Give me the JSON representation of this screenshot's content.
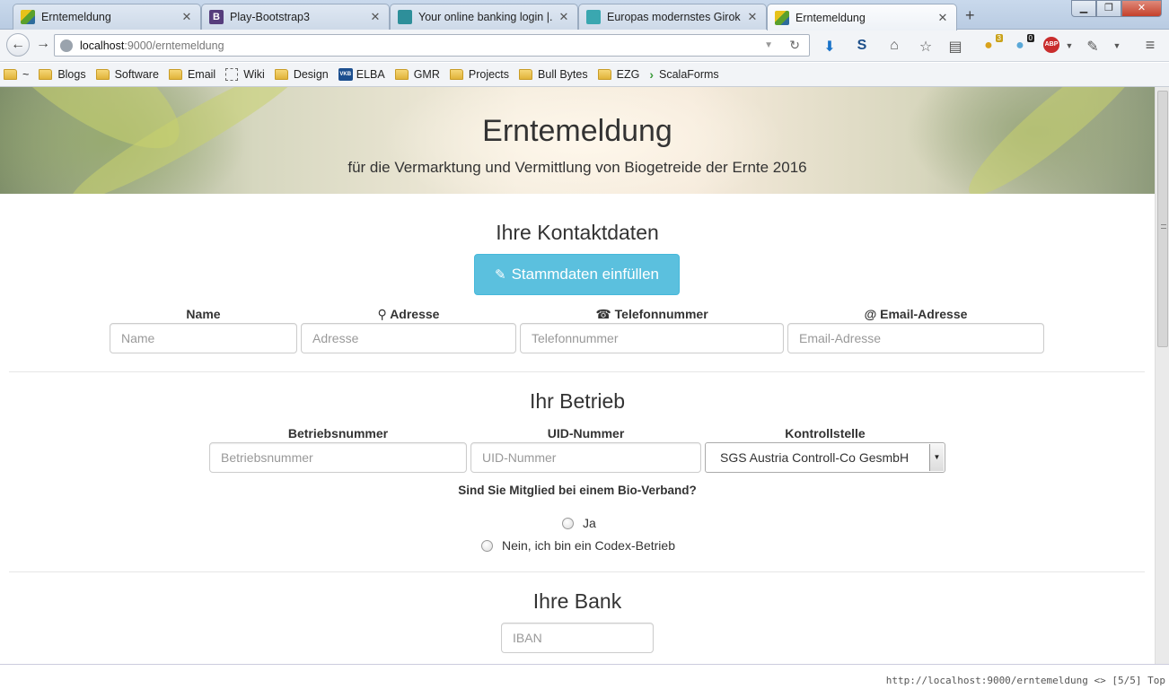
{
  "browser": {
    "tabs": [
      {
        "label": "Erntemeldung",
        "favicon": "erntemeldung-favicon"
      },
      {
        "label": "Play-Bootstrap3",
        "favicon": "bootstrap-favicon"
      },
      {
        "label": "Your online banking login |...",
        "favicon": "bank-favicon"
      },
      {
        "label": "Europas modernstes Girok...",
        "favicon": "bank2-favicon"
      },
      {
        "label": "Erntemeldung",
        "favicon": "erntemeldung-favicon",
        "active": true
      }
    ],
    "new_tab_label": "+",
    "url_host": "localhost",
    "url_path": ":9000/erntemeldung",
    "toolbar_badges": {
      "addon1": "3",
      "addon2": "0"
    },
    "abp_label": "ABP",
    "bookmarks": [
      {
        "label": "~",
        "type": "folder"
      },
      {
        "label": "Blogs",
        "type": "folder"
      },
      {
        "label": "Software",
        "type": "folder"
      },
      {
        "label": "Email",
        "type": "folder"
      },
      {
        "label": "Wiki",
        "type": "dashed"
      },
      {
        "label": "Design",
        "type": "folder"
      },
      {
        "label": "ELBA",
        "type": "vkb"
      },
      {
        "label": "GMR",
        "type": "folder"
      },
      {
        "label": "Projects",
        "type": "folder"
      },
      {
        "label": "Bull Bytes",
        "type": "folder"
      },
      {
        "label": "EZG",
        "type": "folder"
      },
      {
        "label": "ScalaForms",
        "type": "chevron"
      }
    ],
    "vkb_text": "VKB",
    "status_text": "http://localhost:9000/erntemeldung <> [5/5] Top"
  },
  "hero": {
    "title": "Erntemeldung",
    "subtitle": "für die Vermarktung und Vermittlung von Biogetreide der Ernte 2016"
  },
  "contact": {
    "title": "Ihre Kontaktdaten",
    "fill_button": "Stammdaten einfüllen",
    "fields": {
      "name": {
        "label": "Name",
        "placeholder": "Name"
      },
      "address": {
        "label": "Adresse",
        "placeholder": "Adresse",
        "icon": "map-marker-icon"
      },
      "phone": {
        "label": "Telefonnummer",
        "placeholder": "Telefonnummer",
        "icon": "phone-icon"
      },
      "email": {
        "label": "Email-Adresse",
        "placeholder": "Email-Adresse",
        "icon": "at-icon"
      }
    }
  },
  "farm": {
    "title": "Ihr Betrieb",
    "fields": {
      "number": {
        "label": "Betriebsnummer",
        "placeholder": "Betriebsnummer"
      },
      "uid": {
        "label": "UID-Nummer",
        "placeholder": "UID-Nummer"
      },
      "control": {
        "label": "Kontrollstelle",
        "value": "SGS Austria Controll-Co GesmbH"
      }
    },
    "question": "Sind Sie Mitglied bei einem Bio-Verband?",
    "options": {
      "yes": "Ja",
      "no": "Nein, ich bin ein Codex-Betrieb"
    }
  },
  "bank": {
    "title": "Ihre Bank",
    "iban_placeholder": "IBAN"
  },
  "colors": {
    "info_button": "#5bc0de",
    "text": "#333333"
  }
}
